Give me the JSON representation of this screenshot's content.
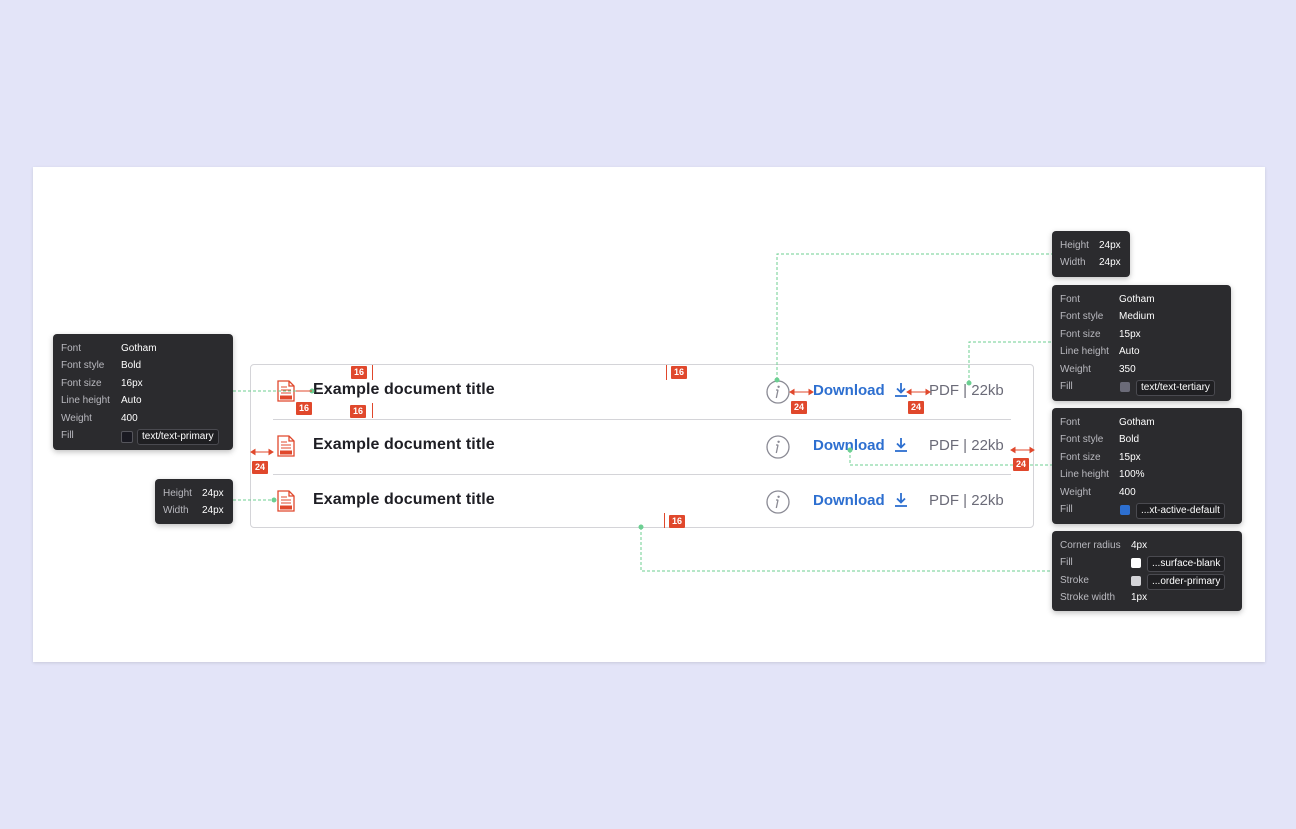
{
  "documents": [
    {
      "title": "Example document title",
      "download_label": "Download",
      "format": "PDF",
      "size": "22kb"
    },
    {
      "title": "Example document title",
      "download_label": "Download",
      "format": "PDF",
      "size": "22kb"
    },
    {
      "title": "Example document title",
      "download_label": "Download",
      "format": "PDF",
      "size": "22kb"
    }
  ],
  "separator": "|",
  "icons": {
    "file": "pdf-file-icon",
    "info": "info-icon",
    "download": "download-icon"
  },
  "colors": {
    "background": "#e3e4f8",
    "text_primary": "#1e1e24",
    "text_tertiary": "#6b6b78",
    "link": "#2d6fd0",
    "spec_marker": "#e0482c",
    "guide_line": "#6ccf92"
  },
  "measurements": {
    "m1": "16",
    "m2": "16",
    "m3": "16",
    "m4": "16",
    "m5": "24",
    "m6": "24",
    "m7": "24",
    "m8": "24",
    "m9": "16"
  },
  "specs": {
    "title_font": {
      "font_k": "Font",
      "font_v": "Gotham",
      "style_k": "Font style",
      "style_v": "Bold",
      "size_k": "Font size",
      "size_v": "16px",
      "lh_k": "Line height",
      "lh_v": "Auto",
      "weight_k": "Weight",
      "weight_v": "400",
      "fill_k": "Fill",
      "fill_v": "text/text-primary",
      "fill_color": "#1a1a22"
    },
    "file_icon_size": {
      "height_k": "Height",
      "height_v": "24px",
      "width_k": "Width",
      "width_v": "24px"
    },
    "info_icon_size": {
      "height_k": "Height",
      "height_v": "24px",
      "width_k": "Width",
      "width_v": "24px"
    },
    "meta_font": {
      "font_k": "Font",
      "font_v": "Gotham",
      "style_k": "Font style",
      "style_v": "Medium",
      "size_k": "Font size",
      "size_v": "15px",
      "lh_k": "Line height",
      "lh_v": "Auto",
      "weight_k": "Weight",
      "weight_v": "350",
      "fill_k": "Fill",
      "fill_v": "text/text-tertiary",
      "fill_color": "#6b6b78"
    },
    "download_font": {
      "font_k": "Font",
      "font_v": "Gotham",
      "style_k": "Font style",
      "style_v": "Bold",
      "size_k": "Font size",
      "size_v": "15px",
      "lh_k": "Line height",
      "lh_v": "100%",
      "weight_k": "Weight",
      "weight_v": "400",
      "fill_k": "Fill",
      "fill_v": "...xt-active-default",
      "fill_color": "#2d6fd0"
    },
    "container": {
      "radius_k": "Corner radius",
      "radius_v": "4px",
      "fill_k": "Fill",
      "fill_v": "...surface-blank",
      "fill_color": "#ffffff",
      "stroke_k": "Stroke",
      "stroke_v": "...order-primary",
      "stroke_color": "#d4d4d8",
      "sw_k": "Stroke width",
      "sw_v": "1px"
    }
  }
}
